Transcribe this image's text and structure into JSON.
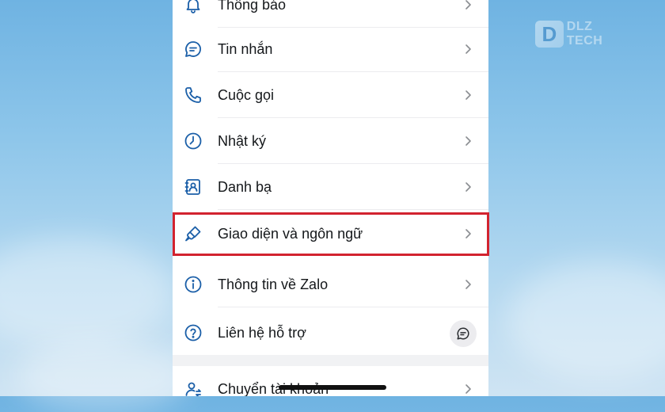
{
  "watermark": {
    "badge": "D",
    "text": "DLZ TECH"
  },
  "menu": {
    "items": [
      {
        "label": "Thông báo",
        "icon": "bell-icon"
      },
      {
        "label": "Tin nhắn",
        "icon": "chat-bubble-icon"
      },
      {
        "label": "Cuộc gọi",
        "icon": "phone-icon"
      },
      {
        "label": "Nhật ký",
        "icon": "clock-icon"
      },
      {
        "label": "Danh bạ",
        "icon": "contacts-book-icon"
      },
      {
        "label": "Giao diện và ngôn ngữ",
        "icon": "paint-brush-icon",
        "highlighted": true
      },
      {
        "label": "Thông tin về Zalo",
        "icon": "info-icon"
      },
      {
        "label": "Liên hệ hỗ trợ",
        "icon": "help-icon",
        "action_icon": "chat-support-icon"
      },
      {
        "label": "Chuyển tài khoản",
        "icon": "switch-account-icon"
      }
    ]
  },
  "colors": {
    "icon_blue": "#1b5fa8",
    "highlight_border": "#d2232f",
    "chevron": "#8a8d91"
  }
}
